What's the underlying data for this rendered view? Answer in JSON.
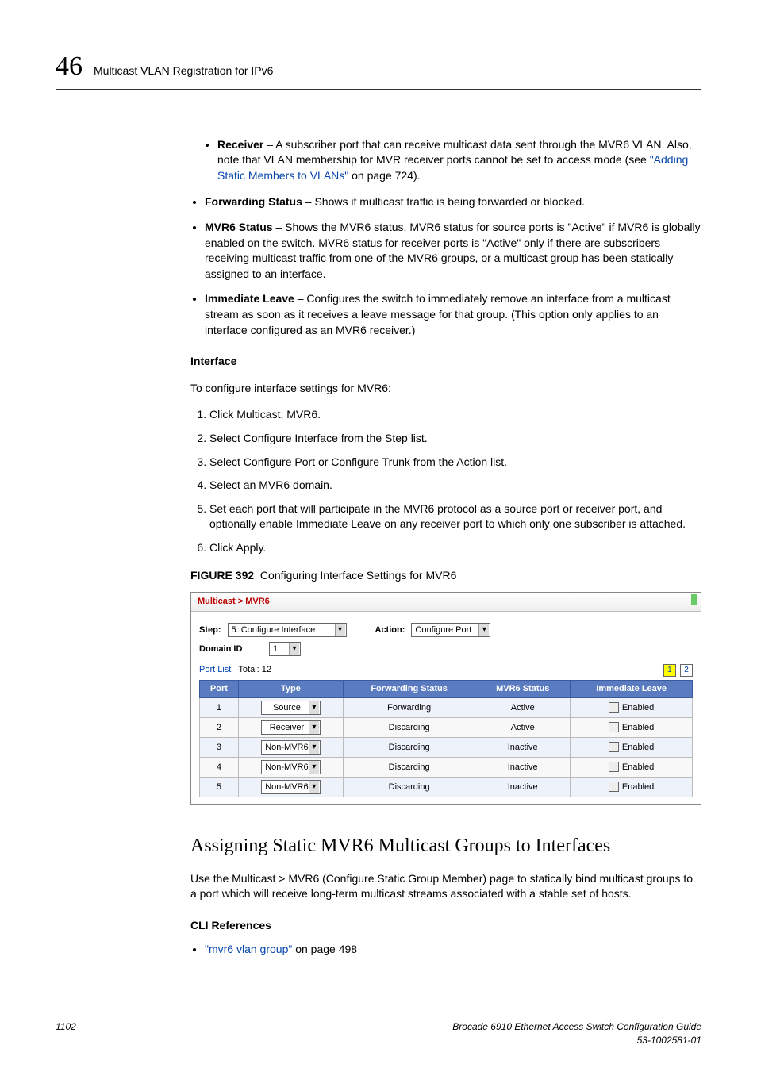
{
  "header": {
    "chapter_number": "46",
    "chapter_title": "Multicast VLAN Registration for IPv6"
  },
  "intro_sublist": {
    "receiver_label": "Receiver",
    "receiver_text_a": " – A subscriber port that can receive multicast data sent through the MVR6 VLAN. Also, note that VLAN membership for MVR receiver ports cannot be set to access mode (see ",
    "receiver_link": "\"Adding Static Members to VLANs\"",
    "receiver_text_b": " on page 724)."
  },
  "bullets": {
    "fs_label": "Forwarding Status",
    "fs_text": " – Shows if multicast traffic is being forwarded or blocked.",
    "mvr_label": "MVR6 Status",
    "mvr_text": " – Shows the MVR6 status. MVR6 status for source ports is \"Active\" if MVR6 is globally enabled on the switch. MVR6 status for receiver ports is \"Active\" only if there are subscribers receiving multicast traffic from one of the MVR6 groups, or a multicast group has been statically assigned to an interface.",
    "il_label": "Immediate Leave",
    "il_text": " – Configures the switch to immediately remove an interface from a multicast stream as soon as it receives a leave message for that group. (This option only applies to an interface configured as an MVR6 receiver.)"
  },
  "interface": {
    "heading": "Interface",
    "intro": "To configure interface settings for MVR6:",
    "steps": [
      "Click Multicast, MVR6.",
      "Select Configure Interface from the Step list.",
      "Select Configure Port or Configure Trunk from the Action list.",
      "Select an MVR6 domain.",
      "Set each port that will participate in the MVR6 protocol as a source port or receiver port, and optionally enable Immediate Leave on any receiver port to which only one subscriber is attached.",
      "Click Apply."
    ]
  },
  "figure": {
    "label": "FIGURE 392",
    "caption": "Configuring Interface Settings for MVR6"
  },
  "shot": {
    "breadcrumb": "Multicast > MVR6",
    "step_label": "Step:",
    "step_value": "5. Configure Interface",
    "action_label": "Action:",
    "action_value": "Configure Port",
    "domain_label": "Domain ID",
    "domain_value": "1",
    "portlist_label": "Port List",
    "portlist_total": "Total: 12",
    "page1": "1",
    "page2": "2",
    "cols": {
      "port": "Port",
      "type": "Type",
      "fs": "Forwarding Status",
      "mvr": "MVR6 Status",
      "il": "Immediate Leave"
    },
    "rows": [
      {
        "port": "1",
        "type": "Source",
        "fs": "Forwarding",
        "mvr": "Active",
        "il": "Enabled"
      },
      {
        "port": "2",
        "type": "Receiver",
        "fs": "Discarding",
        "mvr": "Active",
        "il": "Enabled"
      },
      {
        "port": "3",
        "type": "Non-MVR6",
        "fs": "Discarding",
        "mvr": "Inactive",
        "il": "Enabled"
      },
      {
        "port": "4",
        "type": "Non-MVR6",
        "fs": "Discarding",
        "mvr": "Inactive",
        "il": "Enabled"
      },
      {
        "port": "5",
        "type": "Non-MVR6",
        "fs": "Discarding",
        "mvr": "Inactive",
        "il": "Enabled"
      }
    ]
  },
  "section2": {
    "title": "Assigning Static MVR6 Multicast Groups to Interfaces",
    "para": "Use the Multicast > MVR6 (Configure Static Group Member) page to statically bind multicast groups to a port which will receive long-term multicast streams associated with a stable set of hosts.",
    "cli_heading": "CLI References",
    "cli_link": "\"mvr6 vlan group\"",
    "cli_text": " on page 498"
  },
  "footer": {
    "page": "1102",
    "book": "Brocade 6910 Ethernet Access Switch Configuration Guide",
    "docnum": "53-1002581-01"
  }
}
